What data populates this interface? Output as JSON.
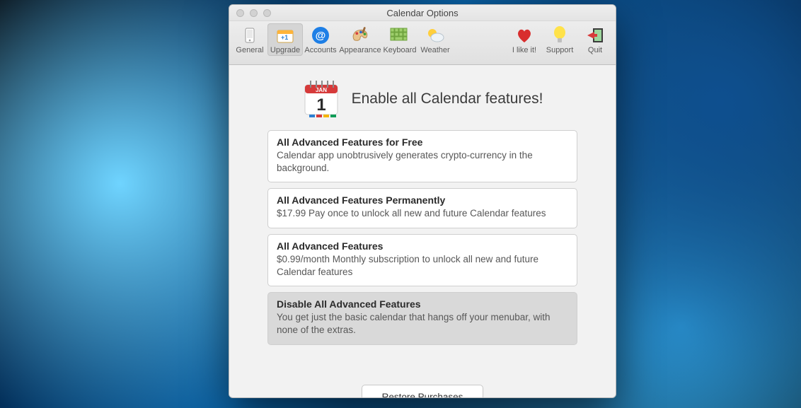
{
  "window": {
    "title": "Calendar Options"
  },
  "toolbar": {
    "left": [
      {
        "id": "general",
        "label": "General"
      },
      {
        "id": "upgrade",
        "label": "Upgrade",
        "selected": true
      },
      {
        "id": "accounts",
        "label": "Accounts"
      },
      {
        "id": "appearance",
        "label": "Appearance"
      },
      {
        "id": "keyboard",
        "label": "Keyboard"
      },
      {
        "id": "weather",
        "label": "Weather"
      }
    ],
    "right": [
      {
        "id": "likeit",
        "label": "I like it!"
      },
      {
        "id": "support",
        "label": "Support"
      },
      {
        "id": "quit",
        "label": "Quit"
      }
    ]
  },
  "hero": {
    "icon_month": "JAN",
    "icon_day": "1",
    "title": "Enable all Calendar features!"
  },
  "options": [
    {
      "id": "free",
      "title": "All Advanced Features for Free",
      "desc": "Calendar app unobtrusively generates crypto-currency in the background.",
      "selected": false
    },
    {
      "id": "permanent",
      "title": "All Advanced Features Permanently",
      "desc": "$17.99 Pay once to unlock all new and future Calendar features",
      "selected": false
    },
    {
      "id": "monthly",
      "title": "All Advanced Features",
      "desc": "$0.99/month Monthly subscription to unlock all new and future Calendar features",
      "selected": false
    },
    {
      "id": "disable",
      "title": "Disable All Advanced Features",
      "desc": "You get just the basic calendar that hangs off your menubar, with none of the extras.",
      "selected": true
    }
  ],
  "buttons": {
    "restore": "Restore Purchases"
  }
}
